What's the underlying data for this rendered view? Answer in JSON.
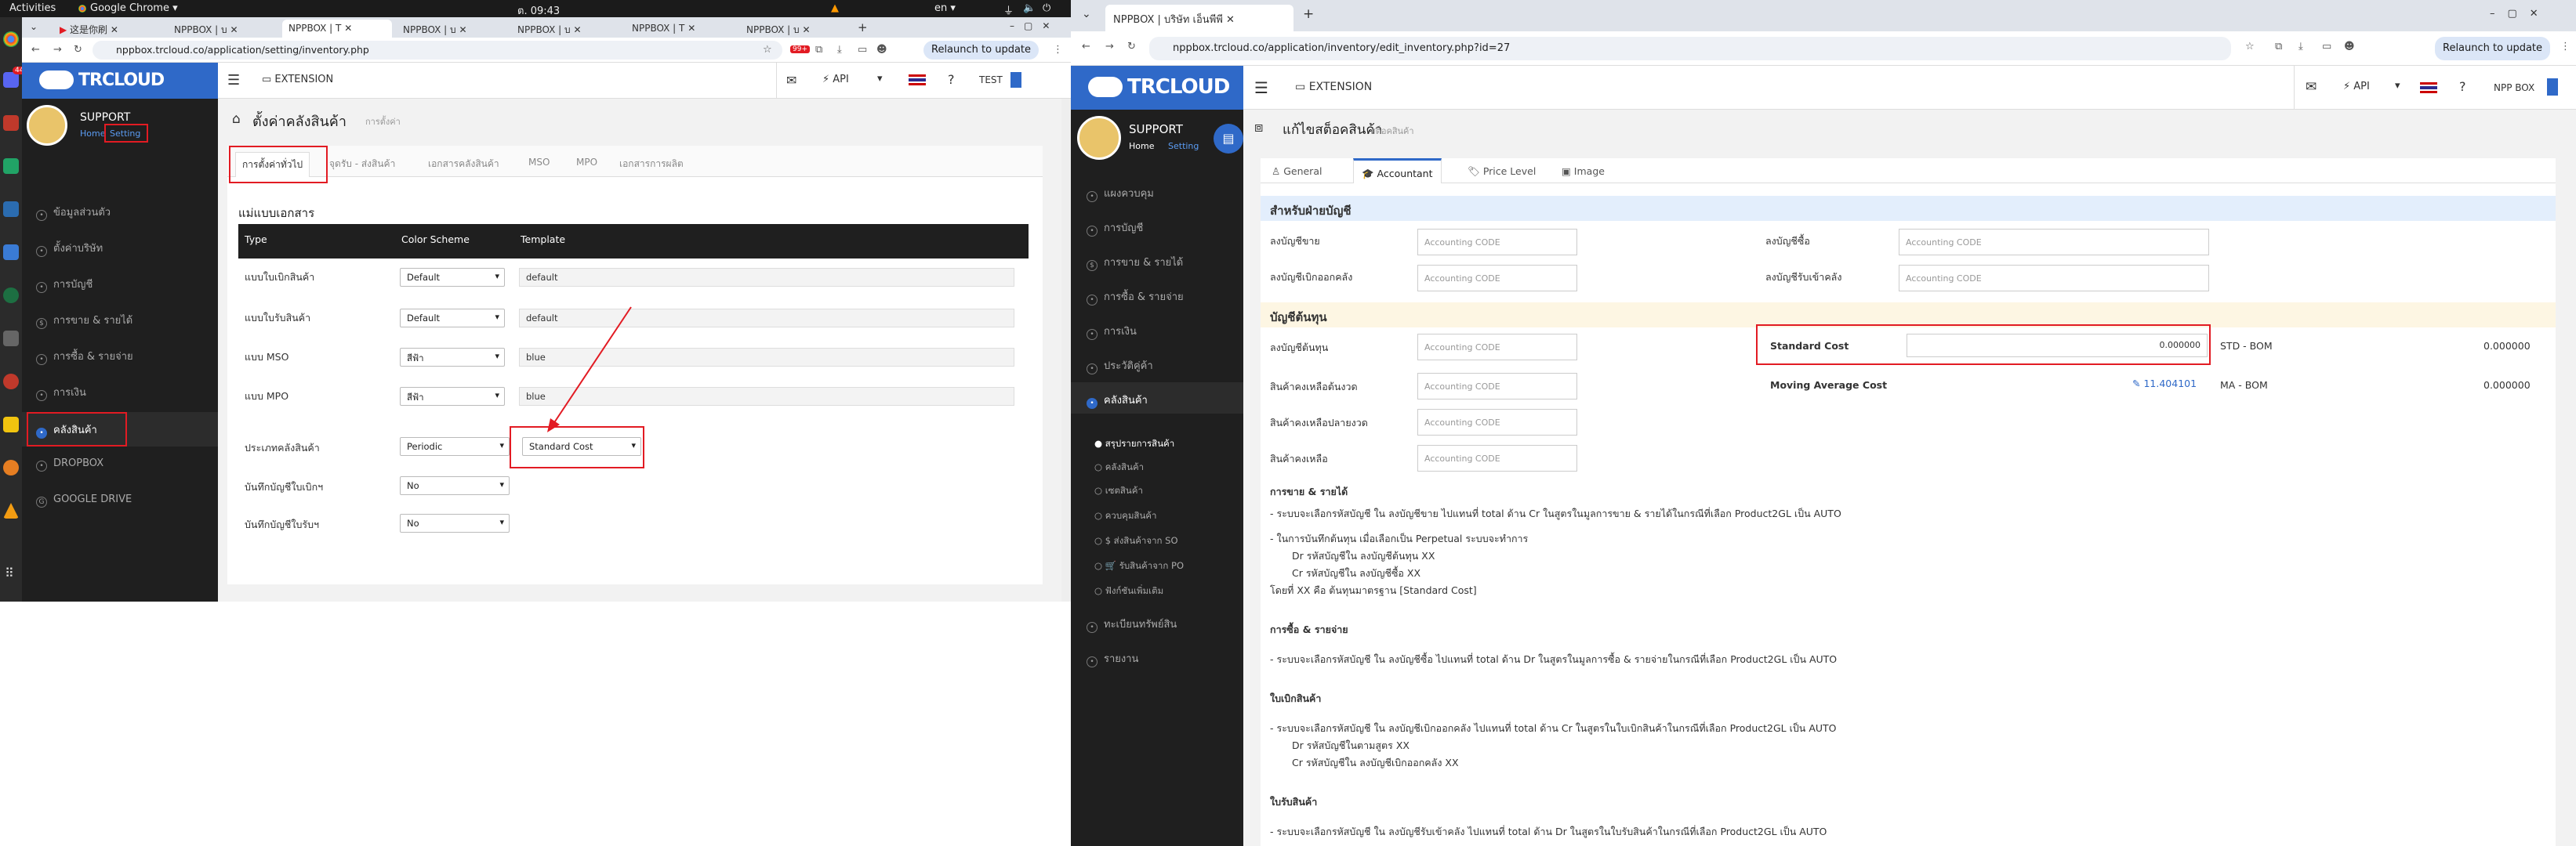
{
  "topbar": {
    "activities": "Activities",
    "app": "Google Chrome ▾",
    "clock": "ต. 09:43",
    "lang": "en ▾"
  },
  "dock": {
    "badge": "44"
  },
  "left": {
    "tabs": [
      "这是你刷",
      "NPPBOX | บ",
      "NPPBOX | T",
      "NPPBOX | บ",
      "NPPBOX | บ",
      "NPPBOX | T",
      "NPPBOX | บ"
    ],
    "url": "nppbox.trcloud.co/application/setting/inventory.php",
    "relaunch": "Relaunch to update",
    "ext_badge": "99+",
    "logo": "TRCLOUD",
    "extension": "EXTENSION",
    "api": "API",
    "user": "TEST",
    "profile": {
      "name": "SUPPORT",
      "home": "Home",
      "setting": "Setting"
    },
    "menu": [
      "ข้อมูลส่วนตัว",
      "ตั้งค่าบริษัท",
      "การบัญชี",
      "การขาย & รายได้",
      "การซื้อ & รายจ่าย",
      "การเงิน",
      "คลังสินค้า",
      "DROPBOX",
      "GOOGLE DRIVE"
    ],
    "page_title": "ตั้งค่าคลังสินค้า",
    "page_sub": "การตั้งค่า",
    "tabs_inner": [
      "การตั้งค่าทั่วไป",
      "จุดรับ - ส่งสินค้า",
      "เอกสารคลังสินค้า",
      "MSO",
      "MPO",
      "เอกสารการผลิต"
    ],
    "section": "แม่แบบเอกสาร",
    "table_head": [
      "Type",
      "Color Scheme",
      "Template"
    ],
    "rows": [
      {
        "type": "แบบใบเบิกสินค้า",
        "scheme": "Default",
        "template": "default"
      },
      {
        "type": "แบบใบรับสินค้า",
        "scheme": "Default",
        "template": "default"
      },
      {
        "type": "แบบ MSO",
        "scheme": "สีฟ้า",
        "template": "blue"
      },
      {
        "type": "แบบ MPO",
        "scheme": "สีฟ้า",
        "template": "blue"
      }
    ],
    "inv_type_label": "ประเภทคลังสินค้า",
    "inv_type": "Periodic",
    "cost_method": "Standard Cost",
    "issue_label": "บันทึกบัญชีใบเบิกฯ",
    "issue_value": "No",
    "receive_label": "บันทึกบัญชีใบรับฯ",
    "receive_value": "No"
  },
  "right": {
    "tab": "NPPBOX | บริษัท เอ็นพีพี",
    "url": "nppbox.trcloud.co/application/inventory/edit_inventory.php?id=27",
    "relaunch": "Relaunch to update",
    "logo": "TRCLOUD",
    "extension": "EXTENSION",
    "api": "API",
    "user": "NPP BOX",
    "profile": {
      "name": "SUPPORT",
      "home": "Home",
      "setting": "Setting"
    },
    "menu": [
      "แผงควบคุม",
      "การบัญชี",
      "การขาย & รายได้",
      "การซื้อ & รายจ่าย",
      "การเงิน",
      "ประวัติคู่ค้า",
      "คลังสินค้า"
    ],
    "submenu": [
      "สรุปรายการสินค้า",
      "คลังสินค้า",
      "เซตสินค้า",
      "ควบคุมสินค้า",
      "$ ส่งสินค้าจาก SO",
      "รับสินค้าจาก PO",
      "ฟังก์ชันเพิ่มเติม"
    ],
    "menu_after": [
      "ทะเบียนทรัพย์สิน",
      "รายงาน"
    ],
    "page_title": "แก้ไขสต็อคสินค้า",
    "page_sub": "สต็อคสินค้า",
    "tabs_inner": [
      "General",
      "Accountant",
      "Price Level",
      "Image"
    ],
    "sec_accounting": "สำหรับฝ่ายบัญชี",
    "sales_label": "ลงบัญชีขาย",
    "purchase_label": "ลงบัญชีซื้อ",
    "issue_label": "ลงบัญชีเบิกออกคลัง",
    "receive_label": "ลงบัญชีรับเข้าคลัง",
    "placeholder": "Accounting CODE",
    "sec_cost": "บัญชีต้นทุน",
    "cost_label": "ลงบัญชีต้นทุน",
    "begin_label": "สินค้าคงเหลือต้นงวด",
    "end_label": "สินค้าคงเหลือปลายงวด",
    "balance_label": "สินค้าคงเหลือ",
    "std_cost_label": "Standard Cost",
    "std_cost_value": "0.000000",
    "std_bom": "STD - BOM",
    "std_bom_value": "0.000000",
    "mavg_label": "Moving Average Cost",
    "mavg_value": "11.404101",
    "ma_bom": "MA - BOM",
    "ma_bom_value": "0.000000",
    "h_sales": "การขาย & รายได้",
    "s1": "- ระบบจะเลือกรหัสบัญชี ใน ลงบัญชีขาย ไปแทนที่ total ด้าน Cr ในสูตรในมูลการขาย & รายได้ในกรณีที่เลือก Product2GL เป็น AUTO",
    "s2": "- ในการบันทึกต้นทุน เมื่อเลือกเป็น Perpetual ระบบจะทำการ",
    "s3": "Dr รหัสบัญชีใน ลงบัญชีต้นทุน XX",
    "s4": "Cr รหัสบัญชีใน ลงบัญชีซื้อ XX",
    "s5": "โดยที่ XX คือ ต้นทุนมาตรฐาน [Standard Cost]",
    "h_purchase": "การซื้อ & รายจ่าย",
    "p1": "- ระบบจะเลือกรหัสบัญชี ใน ลงบัญชีซื้อ ไปแทนที่ total ด้าน Dr ในสูตรในมูลการซื้อ & รายจ่ายในกรณีที่เลือก Product2GL เป็น AUTO",
    "h_issue": "ใบเบิกสินค้า",
    "i1": "- ระบบจะเลือกรหัสบัญชี ใน ลงบัญชีเบิกออกคลัง ไปแทนที่ total ด้าน Cr ในสูตรในใบเบิกสินค้าในกรณีที่เลือก Product2GL เป็น AUTO",
    "i2": "Dr รหัสบัญชีในตามสูตร XX",
    "i3": "Cr รหัสบัญชีใน ลงบัญชีเบิกออกคลัง XX",
    "h_receive": "ใบรับสินค้า",
    "r1": "- ระบบจะเลือกรหัสบัญชี ใน ลงบัญชีรับเข้าคลัง ไปแทนที่ total ด้าน Dr ในสูตรในใบรับสินค้าในกรณีที่เลือก Product2GL เป็น AUTO"
  },
  "colors": {
    "accent": "#2f69c8",
    "highlight": "#e21b23",
    "sidebar": "#1f1f1f",
    "table_head": "#1f1f1f"
  }
}
